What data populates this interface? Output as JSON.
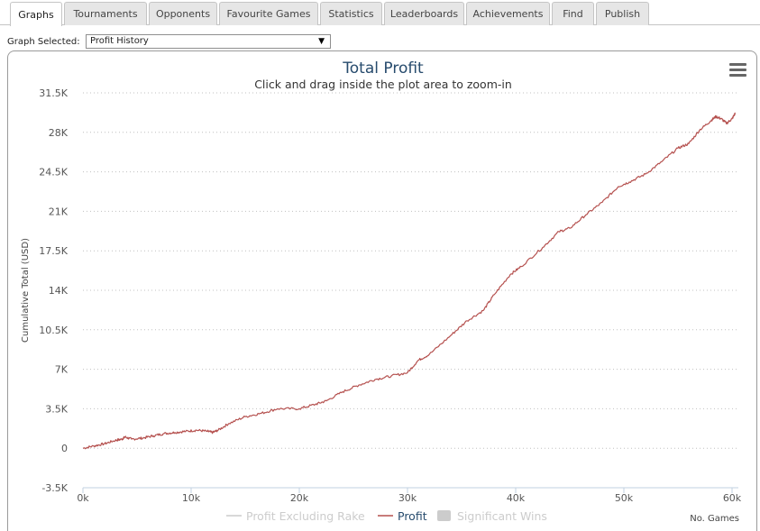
{
  "tabs": [
    {
      "label": "Graphs",
      "active": true
    },
    {
      "label": "Tournaments",
      "active": false
    },
    {
      "label": "Opponents",
      "active": false
    },
    {
      "label": "Favourite Games",
      "active": false
    },
    {
      "label": "Statistics",
      "active": false
    },
    {
      "label": "Leaderboards",
      "active": false
    },
    {
      "label": "Achievements",
      "active": false
    },
    {
      "label": "Find",
      "active": false
    },
    {
      "label": "Publish",
      "active": false
    }
  ],
  "graph_selector": {
    "label": "Graph Selected:",
    "value": "Profit History"
  },
  "chart_menu_icon": "hamburger-menu-icon",
  "colors": {
    "profit_line": "#b5514f",
    "title": "#274b6d",
    "legend_inactive": "#cccccc",
    "grid": "#c0c0c0"
  },
  "chart_data": {
    "type": "line",
    "title": "Total Profit",
    "subtitle": "Click and drag inside the plot area to zoom-in",
    "ylabel": "Cumulative Total (USD)",
    "xlabel": "No. Games",
    "xlim": [
      0,
      60000
    ],
    "ylim": [
      -3500,
      31500
    ],
    "x_ticks": [
      0,
      10000,
      20000,
      30000,
      40000,
      50000,
      60000
    ],
    "x_tick_labels": [
      "0k",
      "10k",
      "20k",
      "30k",
      "40k",
      "50k",
      "60k"
    ],
    "y_ticks": [
      -3500,
      0,
      3500,
      7000,
      10500,
      14000,
      17500,
      21000,
      24500,
      28000,
      31500
    ],
    "y_tick_labels": [
      "-3.5K",
      "0",
      "3.5K",
      "7K",
      "10.5K",
      "14K",
      "17.5K",
      "21K",
      "24.5K",
      "28K",
      "31.5K"
    ],
    "grid": "horizontal-dotted",
    "legend": {
      "placement": "bottom-center",
      "items": [
        {
          "label": "Profit Excluding Rake",
          "kind": "line",
          "active": false
        },
        {
          "label": "Profit",
          "kind": "line",
          "active": true
        },
        {
          "label": "Significant Wins",
          "kind": "box",
          "active": false
        }
      ]
    },
    "series": [
      {
        "name": "Profit",
        "x": [
          0,
          1000,
          2000,
          3000,
          3600,
          3900,
          4500,
          5500,
          6500,
          7500,
          8500,
          9500,
          10500,
          11500,
          12000,
          12500,
          13500,
          15000,
          16500,
          18000,
          20000,
          21500,
          22500,
          24000,
          25500,
          27000,
          28500,
          30000,
          31000,
          32000,
          34000,
          35500,
          37000,
          38000,
          39500,
          40500,
          42500,
          44000,
          45000,
          46500,
          48000,
          49500,
          50500,
          52000,
          53500,
          55000,
          56000,
          57000,
          58000,
          58500,
          59000,
          59500,
          60000,
          60300
        ],
        "y": [
          0,
          200,
          400,
          700,
          800,
          1000,
          800,
          900,
          1100,
          1300,
          1400,
          1500,
          1600,
          1500,
          1400,
          1600,
          2200,
          2800,
          3100,
          3500,
          3500,
          3900,
          4200,
          5000,
          5600,
          6100,
          6400,
          6700,
          7800,
          8300,
          10000,
          11300,
          12200,
          13600,
          15400,
          16100,
          17800,
          19200,
          19500,
          20700,
          21800,
          23200,
          23600,
          24300,
          25400,
          26600,
          27000,
          28200,
          29000,
          29400,
          29200,
          28800,
          29200,
          29700
        ]
      }
    ]
  }
}
